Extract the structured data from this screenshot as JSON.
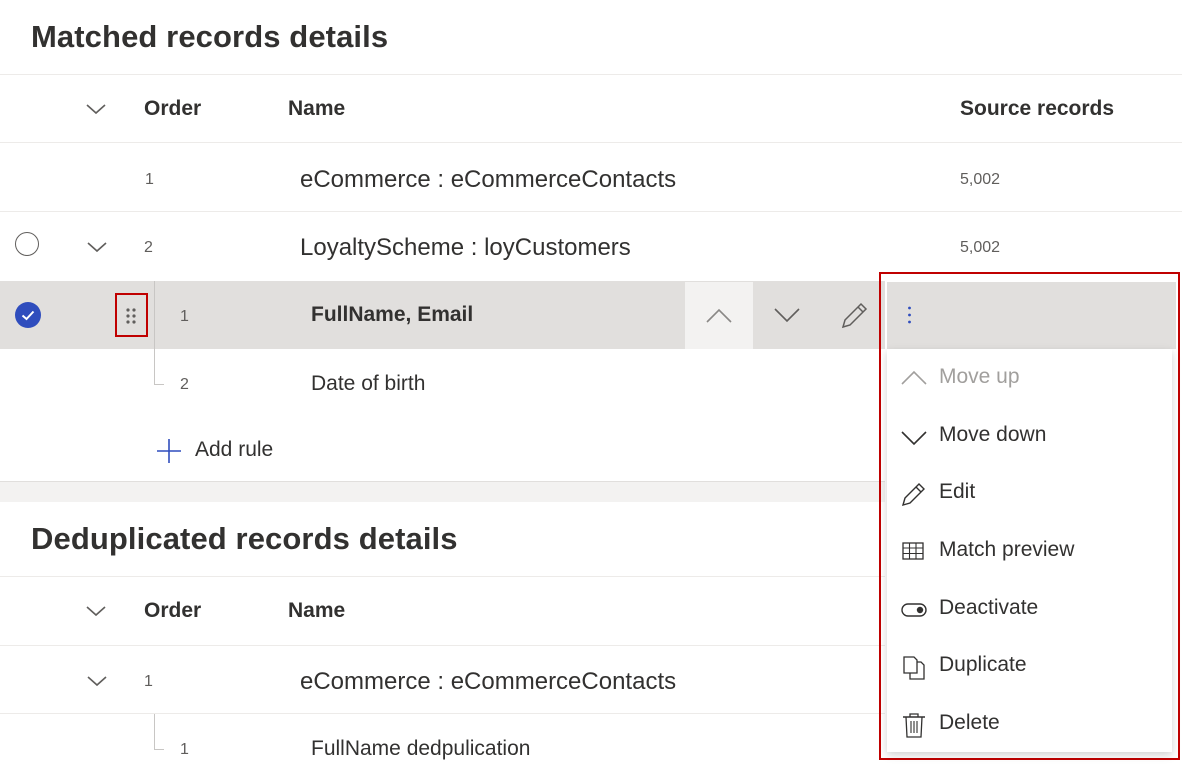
{
  "matched": {
    "title": "Matched records details",
    "headers": {
      "order": "Order",
      "name": "Name",
      "source": "Source records"
    },
    "rows": [
      {
        "order": "1",
        "name": "eCommerce : eCommerceContacts",
        "count": "5,002"
      },
      {
        "order": "2",
        "name": "LoyaltyScheme : loyCustomers",
        "count": "5,002"
      }
    ],
    "rules": [
      {
        "order": "1",
        "name": "FullName, Email"
      },
      {
        "order": "2",
        "name": "Date of birth"
      }
    ],
    "add_rule": "Add rule"
  },
  "dedup": {
    "title": "Deduplicated records details",
    "headers": {
      "order": "Order",
      "name": "Name"
    },
    "rows": [
      {
        "order": "1",
        "name": "eCommerce : eCommerceContacts"
      }
    ],
    "rules": [
      {
        "order": "1",
        "name": "FullName dedpulication"
      }
    ]
  },
  "context_menu": {
    "items": [
      {
        "label": "Move up",
        "icon": "chevron-up-icon",
        "disabled": true
      },
      {
        "label": "Move down",
        "icon": "chevron-down-icon",
        "disabled": false
      },
      {
        "label": "Edit",
        "icon": "pencil-icon",
        "disabled": false
      },
      {
        "label": "Match preview",
        "icon": "table-icon",
        "disabled": false
      },
      {
        "label": "Deactivate",
        "icon": "toggle-icon",
        "disabled": false
      },
      {
        "label": "Duplicate",
        "icon": "copy-icon",
        "disabled": false
      },
      {
        "label": "Delete",
        "icon": "trash-icon",
        "disabled": false
      }
    ]
  },
  "colors": {
    "accent": "#2f4dbd",
    "highlight_border": "#c00000",
    "selected_row": "#e1dfdd"
  }
}
